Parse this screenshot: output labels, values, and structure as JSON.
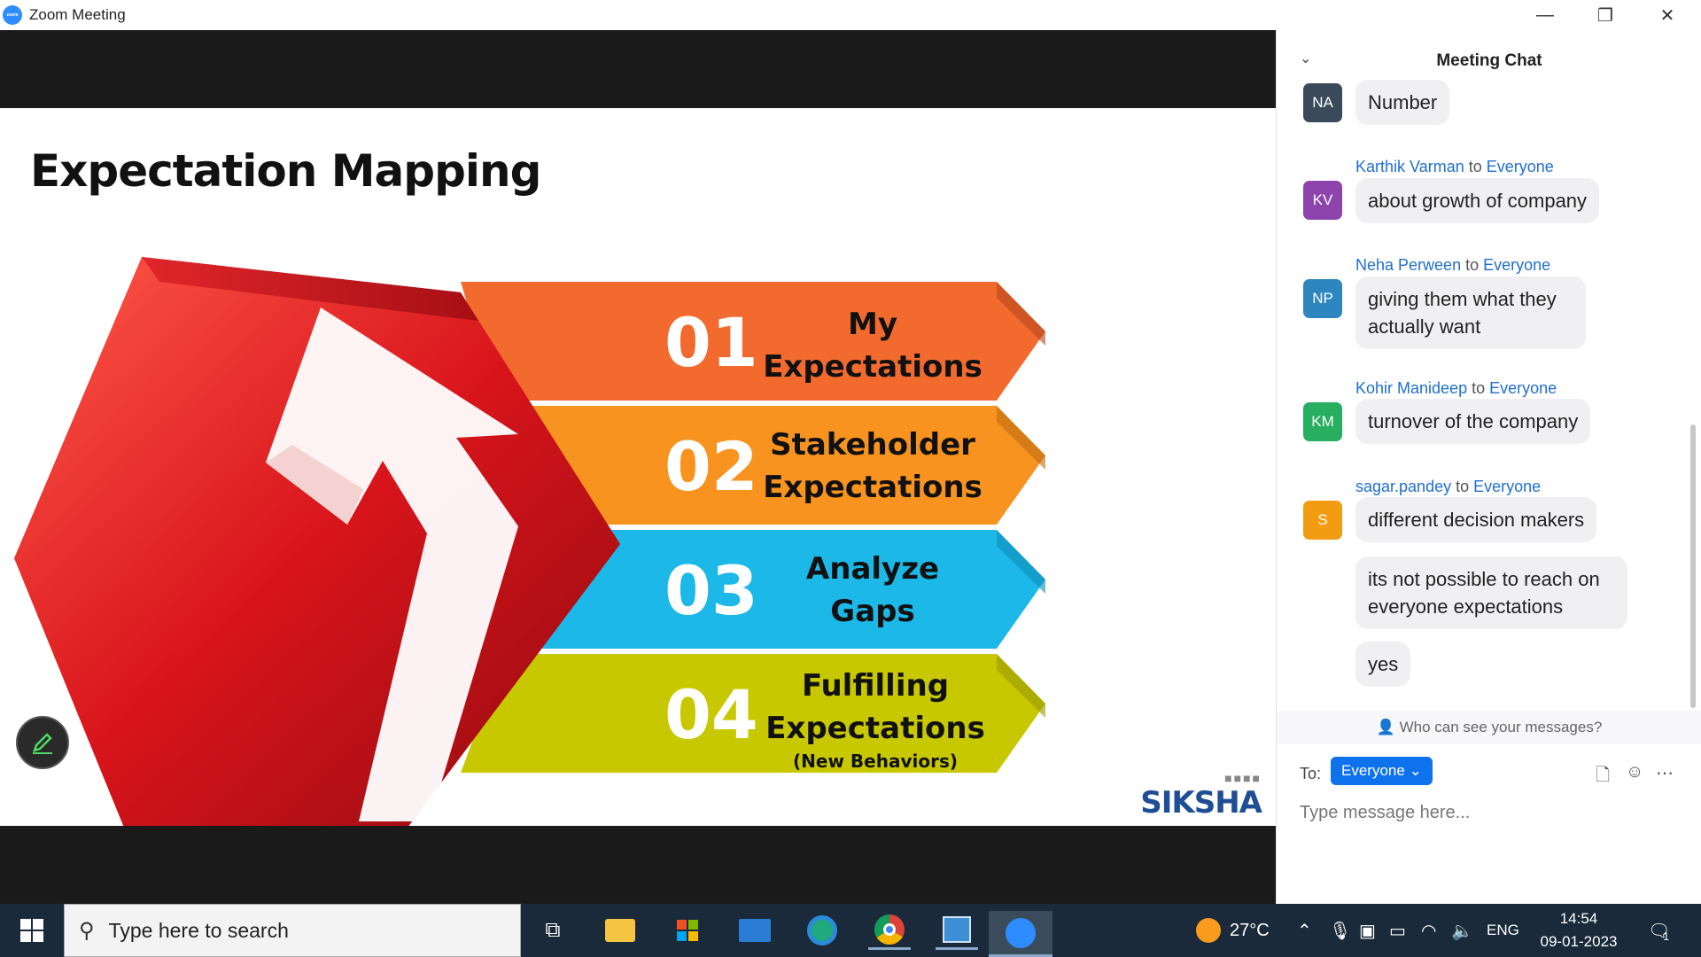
{
  "window": {
    "title": "Zoom Meeting",
    "logo_text": "zoom",
    "minimize": "—",
    "restore": "❐",
    "close": "✕"
  },
  "slide": {
    "title": "Expectation Mapping",
    "steps": [
      {
        "number": "01",
        "label_line1": "My",
        "label_line2": "Expectations",
        "color": "#f26a2e"
      },
      {
        "number": "02",
        "label_line1": "Stakeholder",
        "label_line2": "Expectations",
        "color": "#f7931e"
      },
      {
        "number": "03",
        "label_line1": "Analyze",
        "label_line2": "Gaps",
        "color": "#1cb8e8"
      },
      {
        "number": "04",
        "label_line1": "Fulfilling",
        "label_line2": "Expectations",
        "sub": "(New Behaviors)",
        "color": "#c8c800"
      }
    ],
    "brand": "SIKSHA",
    "brand_dots": "■■■■"
  },
  "chat": {
    "title": "Meeting Chat",
    "to_word": "to",
    "messages": [
      {
        "initials": "NA",
        "avatar_color": "#3b4a5a",
        "sender": "",
        "recipient": "",
        "bubbles": [
          "Number"
        ]
      },
      {
        "initials": "KV",
        "avatar_color": "#8e44ad",
        "sender": "Karthik Varman",
        "recipient": "Everyone",
        "bubbles": [
          "about growth of company"
        ]
      },
      {
        "initials": "NP",
        "avatar_color": "#2e86c1",
        "sender": "Neha Perween",
        "recipient": "Everyone",
        "bubbles": [
          "giving them what they actually want"
        ]
      },
      {
        "initials": "KM",
        "avatar_color": "#27ae60",
        "sender": "Kohir Manideep",
        "recipient": "Everyone",
        "bubbles": [
          "turnover of the company"
        ]
      },
      {
        "initials": "S",
        "avatar_color": "#f39c12",
        "sender": "sagar.pandey",
        "recipient": "Everyone",
        "bubbles": [
          "different decision makers",
          "its not possible to reach on everyone expectations",
          "yes"
        ]
      }
    ],
    "privacy_text": "Who can see your messages?",
    "to_label": "To:",
    "recipient": "Everyone",
    "input_placeholder": "Type message here..."
  },
  "taskbar": {
    "search_placeholder": "Type here to search",
    "temperature": "27°C",
    "language": "ENG",
    "time": "14:54",
    "date": "09-01-2023",
    "notification_count": "1"
  }
}
